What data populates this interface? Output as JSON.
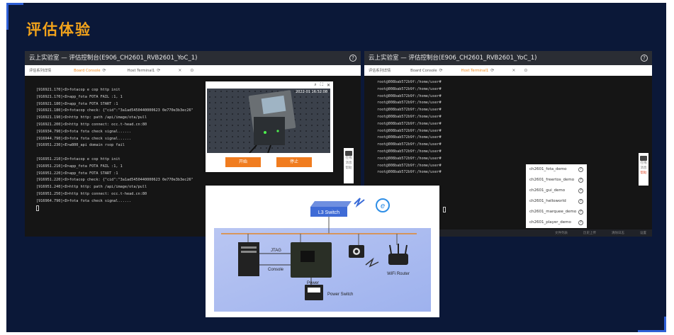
{
  "title": "评估体验",
  "colors": {
    "accent": "#f2a31b",
    "orange": "#f07c1f",
    "bg": "#0b1838"
  },
  "left_window": {
    "title": "云上实验室 — 评估控制台(E906_CH2601_RVB2601_YoC_1)",
    "tabs": [
      {
        "label": "评估系列详情",
        "active": false
      },
      {
        "label": "Board Console",
        "active": true
      },
      {
        "label": "Host Terminal1",
        "active": false
      }
    ],
    "terminal": [
      "[916921.170]<D>fotacop e cop http init",
      "[916921.170]<D>app_fota FOTA FAIL :1, 1",
      "[916921.180]<D>app_fota FOTA START :1",
      "[916921.180]<D>fotacop check: {\"cid\":\"3a1ad5450440000623 0e770e3b3ec26\"",
      "[916921.190]<D>http http: path /api/image/ota/pull",
      "[916921.200]<D>http http connect: occ.t-head.cn:80",
      "[916934.790]<D>fota fota check signal......",
      "[916944.790]<D>fota fota check signal......",
      "[916951.230]<E>w800_api domain rsop fail",
      "",
      "[916951.210]<D>fotacop e cop http init",
      "[916951.210]<D>app_fota FOTA FAIL :1, 1",
      "[916951.220]<D>app_fota FOTA START :1",
      "[916951.220]<D>fotacop check: {\"cid\":\"3a1ad5450440000623 0e770e3b3ec26\"",
      "[916951.240]<D>http http: path /api/image/ota/pull",
      "[916951.250]<D>http http connect: occ.t-head.cn:80",
      "[916964.790]<D>fota fota check signal......"
    ]
  },
  "camera_popup": {
    "timestamp": "2022-01 16:52:08",
    "start_button": "开始",
    "stop_button": "停止"
  },
  "right_window": {
    "title": "云上实验室 — 评估控制台(E906_CH2601_RVB2601_YoC_1)",
    "tabs": [
      {
        "label": "评估系列详情",
        "active": false
      },
      {
        "label": "Board Console",
        "active": false
      },
      {
        "label": "Host Terminal1",
        "active": true
      }
    ],
    "terminal": [
      "root@008bab572b9f:/home/user#",
      "root@008bab572b9f:/home/user#",
      "root@008bab572b9f:/home/user#",
      "root@008bab572b9f:/home/user#",
      "root@008bab572b9f:/home/user#",
      "root@008bab572b9f:/home/user#",
      "root@008bab572b9f:/home/user#",
      "root@008bab572b9f:/home/user#",
      "root@008bab572b9f:/home/user#",
      "root@008bab572b9f:/home/user#",
      "root@008bab572b9f:/home/user#",
      "root@008bab572b9f:/home/user#",
      "root@008bab572b9f:/home/user#",
      "root@008bab572b9f:/home/user#"
    ],
    "demos": [
      "ch2601_fota_demo",
      "ch2601_freertos_demo",
      "ch2601_gui_demo",
      "ch2601_helloworld",
      "ch2601_marquee_demo",
      "ch2601_player_demo"
    ],
    "sidebar": [
      "在线",
      "消息",
      "帮助"
    ],
    "footer": [
      "文件列表",
      "历史上传",
      "清除日志",
      "设置"
    ]
  },
  "left_sidebar": [
    "在线",
    "消息",
    "帮助"
  ],
  "diagram": {
    "switch_label": "L3 Switch",
    "jtag": "JTAG",
    "console": "Console",
    "power": "Power",
    "power_switch": "Power Switch",
    "router": "WiFi Router"
  }
}
